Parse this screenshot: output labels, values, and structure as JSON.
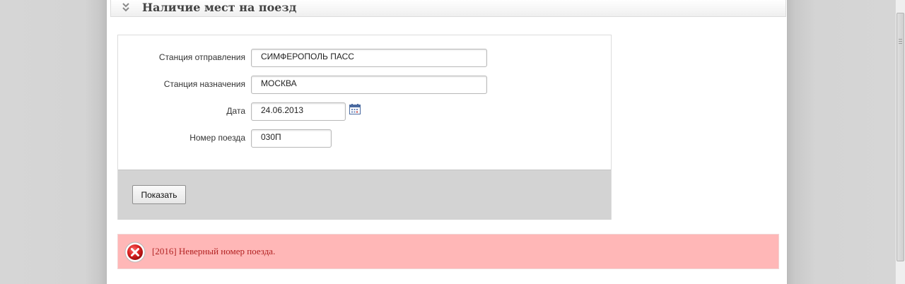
{
  "panel": {
    "title": "Наличие мест на поезд"
  },
  "form": {
    "fields": [
      {
        "label": "Станция отправления",
        "value": "СИМФЕРОПОЛЬ ПАСС"
      },
      {
        "label": "Станция назначения",
        "value": "МОСКВА"
      },
      {
        "label": "Дата",
        "value": "24.06.2013"
      },
      {
        "label": "Номер поезда",
        "value": "030П"
      }
    ],
    "submit_label": "Показать"
  },
  "error": {
    "message": "[2016] Неверный номер поезда."
  },
  "icons": {
    "panel_toggle": "double-chevron-down-icon",
    "date_picker": "calendar-icon",
    "error": "error-x-icon"
  },
  "colors": {
    "error_background": "#ffb7b7",
    "error_text": "#b22222",
    "button_bar": "#d3d3d3"
  }
}
